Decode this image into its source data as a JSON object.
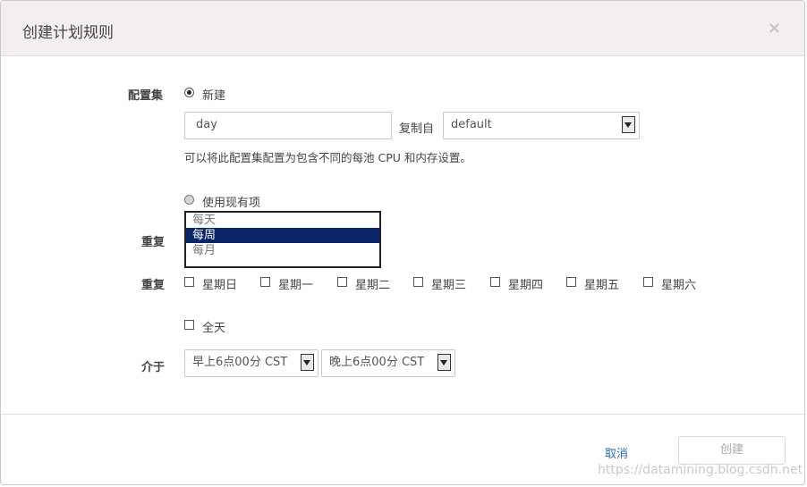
{
  "dialog": {
    "title": "创建计划规则",
    "close_label": "×"
  },
  "config_set": {
    "label": "配置集",
    "new_label": "新建",
    "name_value": "day",
    "copy_from_label": "复制自",
    "copy_from_value": "default",
    "description": "可以将此配置集配置为包含不同的每池 CPU 和内存设置。",
    "use_existing_label": "使用现有项"
  },
  "repeat": {
    "label": "重复",
    "options": [
      "每天",
      "每周",
      "每月"
    ],
    "selected": "每周"
  },
  "weekdays": {
    "label": "重复",
    "days": [
      "星期日",
      "星期一",
      "星期二",
      "星期三",
      "星期四",
      "星期五",
      "星期六"
    ]
  },
  "all_day": {
    "label": "全天"
  },
  "between": {
    "label": "介于",
    "start": "早上6点00分 CST",
    "end": "晚上6点00分 CST"
  },
  "footer": {
    "cancel_label": "取消",
    "create_label": "创建"
  },
  "watermark": "https://datamining.blog.csdn.net"
}
